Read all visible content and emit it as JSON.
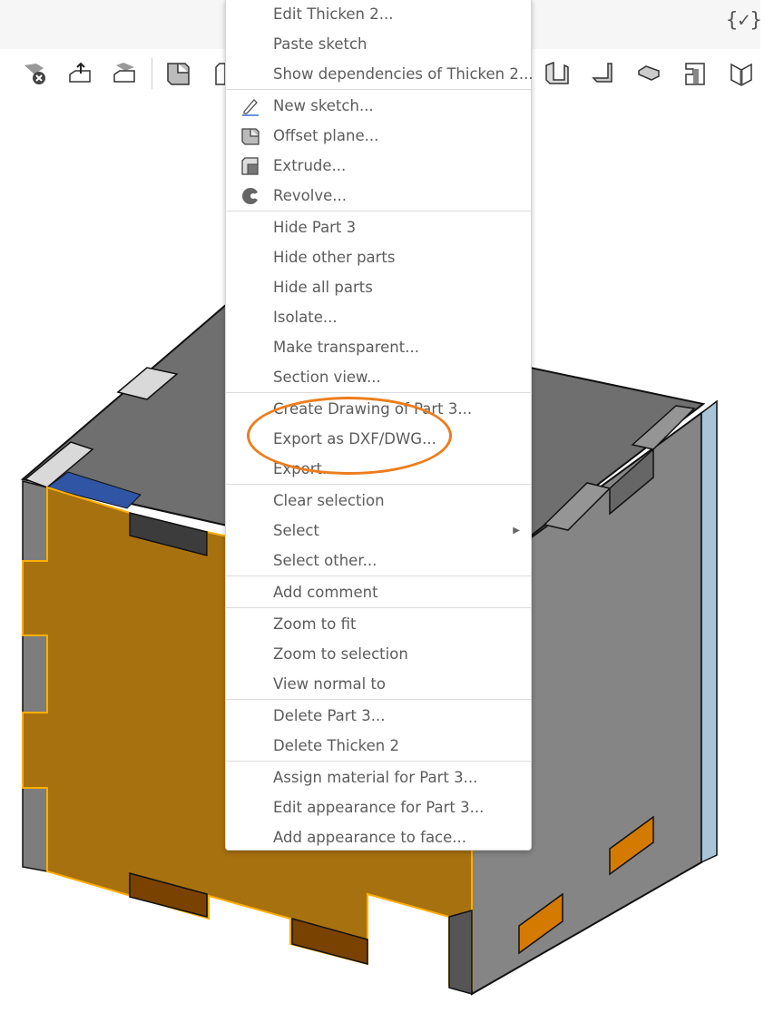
{
  "topbar": {
    "variables_icon": "variables-check-icon",
    "variables_label": "{✓}"
  },
  "toolbar": {
    "icons_left": [
      "delete-part-icon",
      "export-part-icon",
      "sheet-metal-icon",
      "offset-plane-icon",
      "box-icon"
    ],
    "icons_right": [
      "flange-icon",
      "bend-icon",
      "hem-icon",
      "tab-icon",
      "unfold-icon"
    ]
  },
  "context_menu": {
    "groups": [
      [
        {
          "label": "Edit Thicken 2..."
        },
        {
          "label": "Paste sketch"
        },
        {
          "label": "Show dependencies of Thicken 2..."
        }
      ],
      [
        {
          "label": "New sketch...",
          "icon": "pencil-sketch-icon"
        },
        {
          "label": "Offset plane...",
          "icon": "offset-plane-icon"
        },
        {
          "label": "Extrude...",
          "icon": "extrude-icon"
        },
        {
          "label": "Revolve...",
          "icon": "revolve-icon"
        }
      ],
      [
        {
          "label": "Hide Part 3"
        },
        {
          "label": "Hide other parts"
        },
        {
          "label": "Hide all parts"
        },
        {
          "label": "Isolate..."
        },
        {
          "label": "Make transparent..."
        },
        {
          "label": "Section view..."
        }
      ],
      [
        {
          "label": "Create Drawing of Part 3..."
        },
        {
          "label": "Export as DXF/DWG..."
        },
        {
          "label": "Export..."
        }
      ],
      [
        {
          "label": "Clear selection"
        },
        {
          "label": "Select",
          "submenu": true
        },
        {
          "label": "Select other..."
        }
      ],
      [
        {
          "label": "Add comment"
        }
      ],
      [
        {
          "label": "Zoom to fit"
        },
        {
          "label": "Zoom to selection"
        },
        {
          "label": "View normal to"
        }
      ],
      [
        {
          "label": "Delete Part 3..."
        },
        {
          "label": "Delete Thicken 2"
        }
      ],
      [
        {
          "label": "Assign material for Part 3..."
        },
        {
          "label": "Edit appearance for Part 3..."
        },
        {
          "label": "Add appearance to face..."
        }
      ]
    ],
    "highlighted_item": "Export as DXF/DWG...",
    "highlight_color": "#ec7d1d"
  },
  "model": {
    "selected_face_color": "#a8710f",
    "selection_outline_color": "#ffae00",
    "panel_color": "#7f7f7f",
    "top_color": "#6f6f6f",
    "edge_color": "#a9c4d6"
  }
}
